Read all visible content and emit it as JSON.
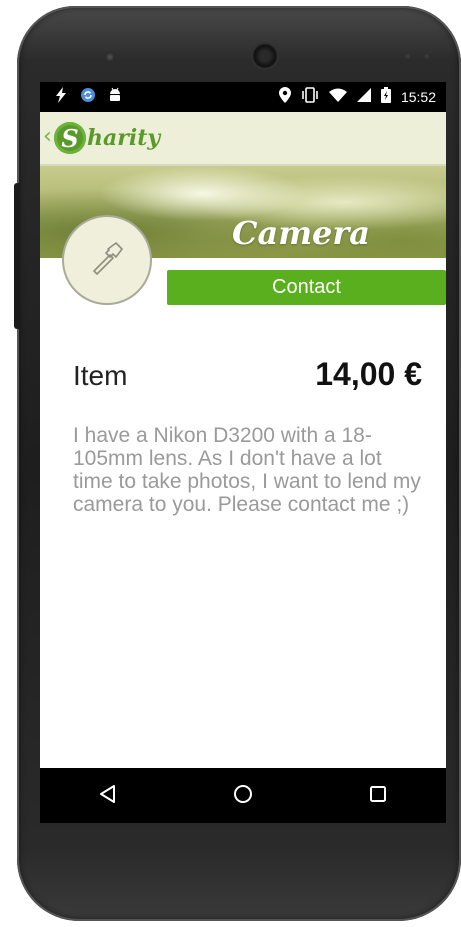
{
  "status_bar": {
    "time": "15:52",
    "left_icons": [
      "charging-bolt-icon",
      "sync-icon",
      "android-icon"
    ],
    "right_icons": [
      "location-pin-icon",
      "vibrate-icon",
      "wifi-icon",
      "signal-icon",
      "battery-icon"
    ]
  },
  "app_bar": {
    "logo_initial": "S",
    "logo_text": "harity",
    "brand_color": "#5a9a2a"
  },
  "item": {
    "title": "Camera",
    "category_icon": "hammer-icon",
    "contact_label": "Contact",
    "type_label": "Item",
    "price": "14,00 €",
    "description": "I have a Nikon D3200 with a 18-105mm lens. As I don't have a lot time to take photos, I want to lend my camera to you. Please contact me ;)"
  },
  "nav_bar": {
    "buttons": [
      "back-triangle-icon",
      "home-circle-icon",
      "recents-square-icon"
    ]
  },
  "colors": {
    "accent_green": "#5aaf1e",
    "app_bar_bg": "#eeefd9",
    "description_text": "#9a9a9a"
  }
}
